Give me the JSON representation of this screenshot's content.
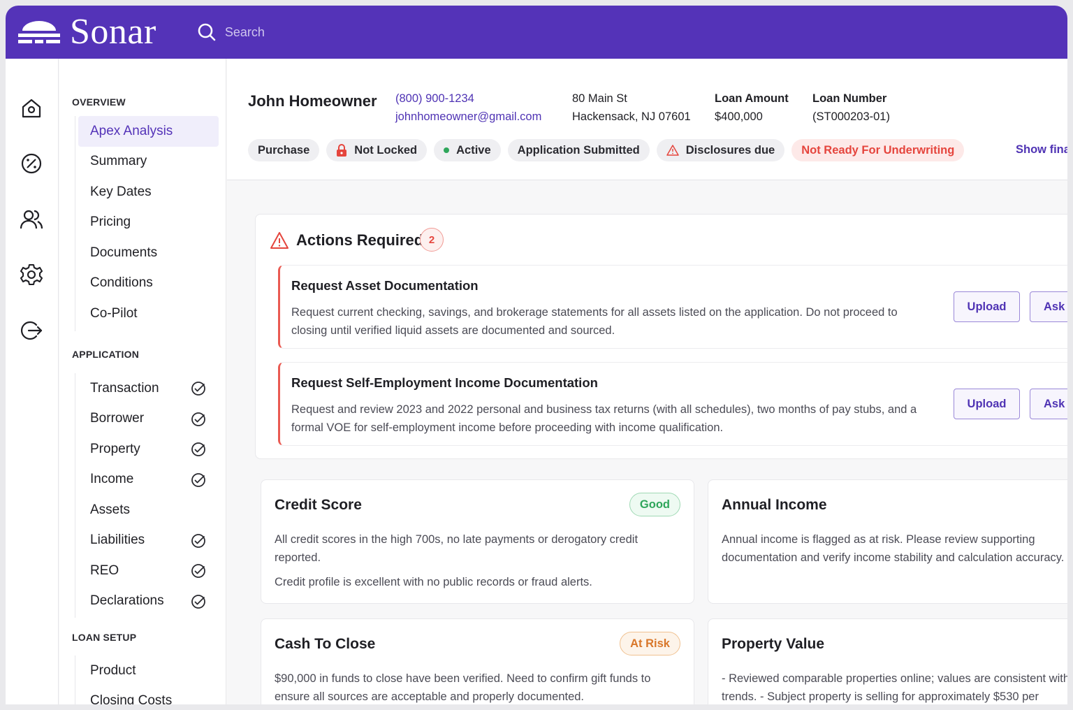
{
  "app": {
    "name": "Sonar",
    "search_placeholder": "Search"
  },
  "rail": {
    "icons": [
      "home-icon",
      "percent-icon",
      "users-icon",
      "gear-icon",
      "logout-icon"
    ]
  },
  "sidebar": {
    "overview_title": "OVERVIEW",
    "overview_items": [
      {
        "label": "Apex Analysis",
        "active": true
      },
      {
        "label": "Summary"
      },
      {
        "label": "Key Dates"
      },
      {
        "label": "Pricing"
      },
      {
        "label": "Documents"
      },
      {
        "label": "Conditions"
      },
      {
        "label": "Co-Pilot"
      }
    ],
    "application_title": "APPLICATION",
    "application_items": [
      {
        "label": "Transaction",
        "checked": true
      },
      {
        "label": "Borrower",
        "checked": true
      },
      {
        "label": "Property",
        "checked": true
      },
      {
        "label": "Income",
        "checked": true
      },
      {
        "label": "Assets",
        "checked": false
      },
      {
        "label": "Liabilities",
        "checked": true
      },
      {
        "label": "REO",
        "checked": true
      },
      {
        "label": "Declarations",
        "checked": true
      }
    ],
    "loan_setup_title": "LOAN SETUP",
    "loan_setup_items": [
      {
        "label": "Product"
      },
      {
        "label": "Closing Costs"
      }
    ]
  },
  "header": {
    "borrower_name": "John Homeowner",
    "phone": "(800) 900-1234",
    "email": "johnhomeowner@gmail.com",
    "address_line1": "80 Main St",
    "address_line2": "Hackensack, NJ 07601",
    "loan_amount_label": "Loan Amount",
    "loan_amount": "$400,000",
    "loan_number_label": "Loan Number",
    "loan_number": "(ST000203-01)",
    "tags": {
      "purchase": "Purchase",
      "not_locked": "Not Locked",
      "active": "Active",
      "application_submitted": "Application Submitted",
      "disclosures_due": "Disclosures due",
      "not_ready": "Not Ready For Underwriting"
    },
    "show_link": "Show fina"
  },
  "actions": {
    "title": "Actions Required",
    "count": "2",
    "items": [
      {
        "title": "Request Asset Documentation",
        "description": "Request current checking, savings, and brokerage statements for all assets listed on the application. Do not proceed to closing until verified liquid assets are documented and sourced.",
        "upload_label": "Upload",
        "ask_label": "Ask A"
      },
      {
        "title": "Request Self-Employment Income Documentation",
        "description": "Request and review 2023 and 2022 personal and business tax returns (with all schedules), two months of pay stubs, and a formal VOE for self-employment income before proceeding with income qualification.",
        "upload_label": "Upload",
        "ask_label": "Ask A"
      }
    ]
  },
  "cards": {
    "credit": {
      "title": "Credit Score",
      "status": "Good",
      "text1": "All credit scores in the high 700s, no late payments or derogatory credit reported.",
      "text2": "Credit profile is excellent with no public records or fraud alerts."
    },
    "income": {
      "title": "Annual Income",
      "text1": "Annual income is flagged as at risk. Please review supporting documentation and verify income stability and calculation accuracy."
    },
    "cash": {
      "title": "Cash To Close",
      "status": "At Risk",
      "text1": "$90,000 in funds to close have been verified. Need to confirm gift funds to ensure all sources are acceptable and properly documented."
    },
    "property": {
      "title": "Property Value",
      "text1": "- Reviewed comparable properties online; values are consistent with market trends. - Subject property is selling for approximately $530 per"
    }
  },
  "colors": {
    "brand": "#5433b8",
    "link": "#4f33b4",
    "danger": "#e5453d",
    "success": "#2fa65b",
    "warning": "#d9772a"
  }
}
